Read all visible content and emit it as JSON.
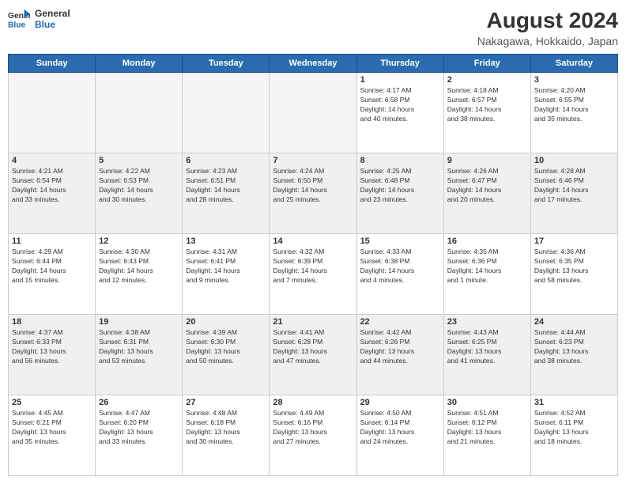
{
  "header": {
    "logo_line1": "General",
    "logo_line2": "Blue",
    "main_title": "August 2024",
    "subtitle": "Nakagawa, Hokkaido, Japan"
  },
  "days_of_week": [
    "Sunday",
    "Monday",
    "Tuesday",
    "Wednesday",
    "Thursday",
    "Friday",
    "Saturday"
  ],
  "weeks": [
    [
      {
        "day": "",
        "empty": true
      },
      {
        "day": "",
        "empty": true
      },
      {
        "day": "",
        "empty": true
      },
      {
        "day": "",
        "empty": true
      },
      {
        "day": "1",
        "info": "Sunrise: 4:17 AM\nSunset: 6:58 PM\nDaylight: 14 hours\nand 40 minutes."
      },
      {
        "day": "2",
        "info": "Sunrise: 4:18 AM\nSunset: 6:57 PM\nDaylight: 14 hours\nand 38 minutes."
      },
      {
        "day": "3",
        "info": "Sunrise: 4:20 AM\nSunset: 6:55 PM\nDaylight: 14 hours\nand 35 minutes."
      }
    ],
    [
      {
        "day": "4",
        "info": "Sunrise: 4:21 AM\nSunset: 6:54 PM\nDaylight: 14 hours\nand 33 minutes."
      },
      {
        "day": "5",
        "info": "Sunrise: 4:22 AM\nSunset: 6:53 PM\nDaylight: 14 hours\nand 30 minutes."
      },
      {
        "day": "6",
        "info": "Sunrise: 4:23 AM\nSunset: 6:51 PM\nDaylight: 14 hours\nand 28 minutes."
      },
      {
        "day": "7",
        "info": "Sunrise: 4:24 AM\nSunset: 6:50 PM\nDaylight: 14 hours\nand 25 minutes."
      },
      {
        "day": "8",
        "info": "Sunrise: 4:25 AM\nSunset: 6:48 PM\nDaylight: 14 hours\nand 23 minutes."
      },
      {
        "day": "9",
        "info": "Sunrise: 4:26 AM\nSunset: 6:47 PM\nDaylight: 14 hours\nand 20 minutes."
      },
      {
        "day": "10",
        "info": "Sunrise: 4:28 AM\nSunset: 6:46 PM\nDaylight: 14 hours\nand 17 minutes."
      }
    ],
    [
      {
        "day": "11",
        "info": "Sunrise: 4:29 AM\nSunset: 6:44 PM\nDaylight: 14 hours\nand 15 minutes."
      },
      {
        "day": "12",
        "info": "Sunrise: 4:30 AM\nSunset: 6:43 PM\nDaylight: 14 hours\nand 12 minutes."
      },
      {
        "day": "13",
        "info": "Sunrise: 4:31 AM\nSunset: 6:41 PM\nDaylight: 14 hours\nand 9 minutes."
      },
      {
        "day": "14",
        "info": "Sunrise: 4:32 AM\nSunset: 6:39 PM\nDaylight: 14 hours\nand 7 minutes."
      },
      {
        "day": "15",
        "info": "Sunrise: 4:33 AM\nSunset: 6:38 PM\nDaylight: 14 hours\nand 4 minutes."
      },
      {
        "day": "16",
        "info": "Sunrise: 4:35 AM\nSunset: 6:36 PM\nDaylight: 14 hours\nand 1 minute."
      },
      {
        "day": "17",
        "info": "Sunrise: 4:36 AM\nSunset: 6:35 PM\nDaylight: 13 hours\nand 58 minutes."
      }
    ],
    [
      {
        "day": "18",
        "info": "Sunrise: 4:37 AM\nSunset: 6:33 PM\nDaylight: 13 hours\nand 56 minutes."
      },
      {
        "day": "19",
        "info": "Sunrise: 4:38 AM\nSunset: 6:31 PM\nDaylight: 13 hours\nand 53 minutes."
      },
      {
        "day": "20",
        "info": "Sunrise: 4:39 AM\nSunset: 6:30 PM\nDaylight: 13 hours\nand 50 minutes."
      },
      {
        "day": "21",
        "info": "Sunrise: 4:41 AM\nSunset: 6:28 PM\nDaylight: 13 hours\nand 47 minutes."
      },
      {
        "day": "22",
        "info": "Sunrise: 4:42 AM\nSunset: 6:26 PM\nDaylight: 13 hours\nand 44 minutes."
      },
      {
        "day": "23",
        "info": "Sunrise: 4:43 AM\nSunset: 6:25 PM\nDaylight: 13 hours\nand 41 minutes."
      },
      {
        "day": "24",
        "info": "Sunrise: 4:44 AM\nSunset: 6:23 PM\nDaylight: 13 hours\nand 38 minutes."
      }
    ],
    [
      {
        "day": "25",
        "info": "Sunrise: 4:45 AM\nSunset: 6:21 PM\nDaylight: 13 hours\nand 35 minutes."
      },
      {
        "day": "26",
        "info": "Sunrise: 4:47 AM\nSunset: 6:20 PM\nDaylight: 13 hours\nand 33 minutes."
      },
      {
        "day": "27",
        "info": "Sunrise: 4:48 AM\nSunset: 6:18 PM\nDaylight: 13 hours\nand 30 minutes."
      },
      {
        "day": "28",
        "info": "Sunrise: 4:49 AM\nSunset: 6:16 PM\nDaylight: 13 hours\nand 27 minutes."
      },
      {
        "day": "29",
        "info": "Sunrise: 4:50 AM\nSunset: 6:14 PM\nDaylight: 13 hours\nand 24 minutes."
      },
      {
        "day": "30",
        "info": "Sunrise: 4:51 AM\nSunset: 6:12 PM\nDaylight: 13 hours\nand 21 minutes."
      },
      {
        "day": "31",
        "info": "Sunrise: 4:52 AM\nSunset: 6:11 PM\nDaylight: 13 hours\nand 18 minutes."
      }
    ]
  ]
}
